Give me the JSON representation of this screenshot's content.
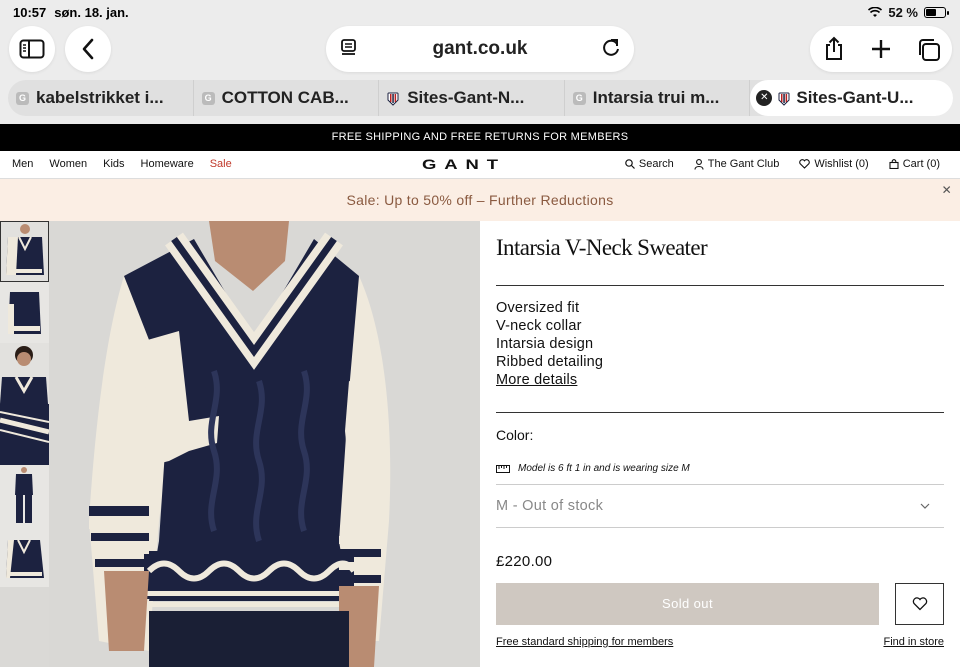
{
  "status_bar": {
    "time": "10:57",
    "date": "søn. 18. jan.",
    "battery": "52 %"
  },
  "browser": {
    "url": "gant.co.uk",
    "tabs": [
      {
        "label": "kabelstrikket i...",
        "favicon": "G"
      },
      {
        "label": "COTTON CAB...",
        "favicon": "G"
      },
      {
        "label": "Sites-Gant-N...",
        "favicon": "shield"
      },
      {
        "label": "Intarsia trui m...",
        "favicon": "G"
      },
      {
        "label": "Sites-Gant-U...",
        "favicon": "shield",
        "active": true
      }
    ]
  },
  "promo_bar": "FREE SHIPPING AND FREE RETURNS FOR MEMBERS",
  "nav": {
    "left": [
      "Men",
      "Women",
      "Kids",
      "Homeware",
      "Sale"
    ],
    "logo": "GANT",
    "search": "Search",
    "club": "The Gant Club",
    "wishlist": "Wishlist (0)",
    "cart": "Cart (0)"
  },
  "sale_banner": "Sale: Up to 50% off – Further Reductions",
  "product": {
    "title": "Intarsia V-Neck Sweater",
    "features": [
      "Oversized fit",
      "V-neck collar",
      "Intarsia design",
      "Ribbed detailing"
    ],
    "more_details": "More details",
    "color_label": "Color:",
    "model_info": "Model is 6 ft 1 in and is wearing size M",
    "size_select": "M - Out of stock",
    "price": "£220.00",
    "sold_out": "Sold out",
    "shipping_link": "Free standard shipping for members",
    "store_link": "Find in store"
  },
  "colors": {
    "navy": "#1c2240",
    "cream": "#efe9dc",
    "sale_red": "#c0392b",
    "banner_bg": "#fbeee4",
    "sold_btn": "#cfc8c1"
  }
}
